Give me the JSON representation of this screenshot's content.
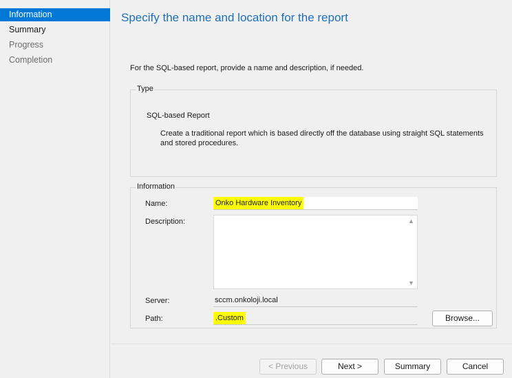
{
  "nav": {
    "items": [
      {
        "label": "Information",
        "state": "active"
      },
      {
        "label": "Summary",
        "state": "done"
      },
      {
        "label": "Progress",
        "state": "pending"
      },
      {
        "label": "Completion",
        "state": "pending"
      }
    ]
  },
  "page": {
    "title": "Specify the name and location for the report",
    "instruction": "For the SQL-based report, provide a name and description, if needed."
  },
  "type_group": {
    "label": "Type",
    "name": "SQL-based Report",
    "description": "Create a traditional report which is based directly off the database using straight SQL statements and stored procedures."
  },
  "info_group": {
    "label": "Information",
    "name_label": "Name:",
    "name_value": "Onko Hardware Inventory",
    "description_label": "Description:",
    "description_value": "",
    "server_label": "Server:",
    "server_value": "sccm.onkoloji.local",
    "path_label": "Path:",
    "path_value": ".Custom",
    "browse_label": "Browse..."
  },
  "footer": {
    "previous_label": "< Previous",
    "next_label": "Next >",
    "summary_label": "Summary",
    "cancel_label": "Cancel"
  },
  "colors": {
    "accent": "#0078d7",
    "title": "#1f6fb5",
    "highlight": "#ffff00"
  }
}
